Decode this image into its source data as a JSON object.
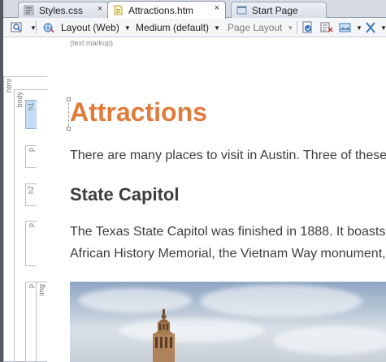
{
  "tabs": [
    {
      "label": "Styles.css",
      "close": "×",
      "icon": "css-file-icon"
    },
    {
      "label": "Attractions.htm",
      "close": "×",
      "icon": "htm-file-icon",
      "active": true
    },
    {
      "label": "Start Page",
      "icon": "start-page-icon"
    }
  ],
  "toolbar": {
    "layout": "Layout (Web)",
    "size": "Medium (default)",
    "page_layout": "Page Layout"
  },
  "markup_label": "(text markup)",
  "ruler": {
    "html": "html",
    "body": "body",
    "h1": "h1",
    "p1": "p",
    "h2": "h2",
    "p2": "p",
    "p3": "p",
    "img": "img"
  },
  "document": {
    "h1": "Attractions",
    "p1": "There are many places to visit in Austin. Three of these",
    "h2": "State Capitol",
    "p2_line1": "The Texas State Capitol was finished in 1888. It boasts",
    "p2_line2": "African History Memorial, the Vietnam Way monument,"
  },
  "colors": {
    "heading_accent": "#e07b3c",
    "body_text": "#3d3d3d",
    "active_tag": "#c5ddf4"
  }
}
